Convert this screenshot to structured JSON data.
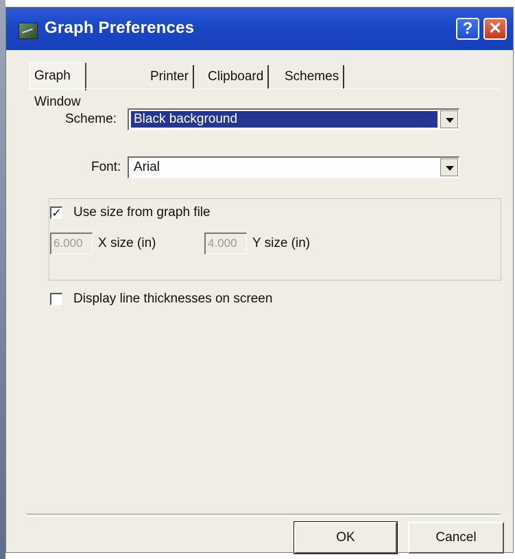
{
  "window": {
    "title": "Graph Preferences",
    "help_label": "?",
    "close_label": "✕",
    "titlebar_color": "#1a47c6"
  },
  "tabs": [
    {
      "label": "Graph Window",
      "active": true
    },
    {
      "label": "Printer",
      "active": false
    },
    {
      "label": "Clipboard",
      "active": false
    },
    {
      "label": "Schemes",
      "active": false
    }
  ],
  "graph_window": {
    "scheme_label": "Scheme:",
    "scheme_value": "Black background",
    "font_label": "Font:",
    "font_value": "Arial",
    "use_size_checkbox": {
      "label": "Use size from graph file",
      "checked": true,
      "mark": "✓"
    },
    "x_size": {
      "value": "6.000",
      "label": "X size (in)"
    },
    "y_size": {
      "value": "4.000",
      "label": "Y size (in)"
    },
    "line_thickness_checkbox": {
      "label": "Display line thicknesses on screen",
      "checked": false,
      "mark": ""
    }
  },
  "buttons": {
    "ok_label": "OK",
    "cancel_label": "Cancel"
  }
}
